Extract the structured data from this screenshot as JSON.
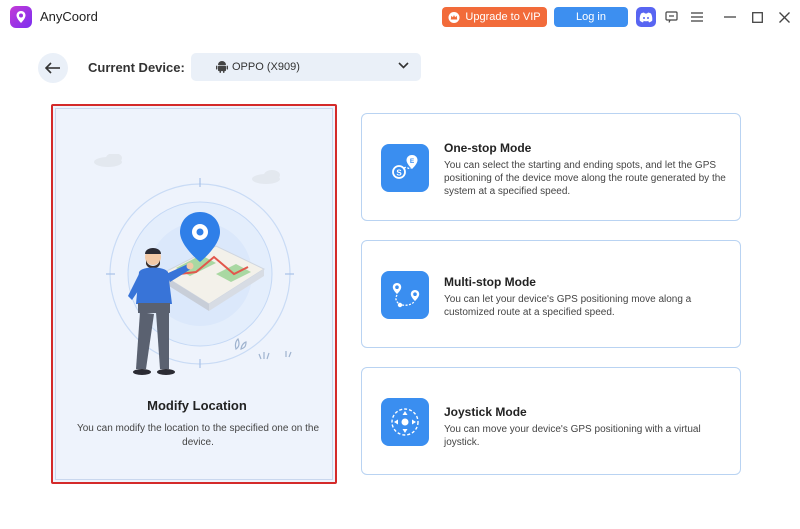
{
  "app": {
    "title": "AnyCoord",
    "upgrade_label": "Upgrade to VIP",
    "login_label": "Log in"
  },
  "device": {
    "label": "Current Device:",
    "selected": "OPPO (X909)"
  },
  "main_mode": {
    "title": "Modify Location",
    "description": "You can modify the location to the specified one on the device."
  },
  "modes": [
    {
      "title": "One-stop Mode",
      "description": "You can select the starting and ending spots, and let the GPS positioning of the device move along the route generated by the system at a specified speed.",
      "icon": "one-stop-route-icon"
    },
    {
      "title": "Multi-stop Mode",
      "description": "You can let your device's GPS positioning move along a customized route at a specified speed.",
      "icon": "multi-stop-route-icon"
    },
    {
      "title": "Joystick Mode",
      "description": "You can move your device's GPS positioning with a virtual joystick.",
      "icon": "joystick-icon"
    }
  ],
  "colors": {
    "accent": "#3a8ef0",
    "vip": "#f26b3a",
    "login": "#3d8ff0",
    "selected_border": "#d42a2a",
    "card_border": "#b9d3f2",
    "main_card_bg": "#eef3fc"
  }
}
